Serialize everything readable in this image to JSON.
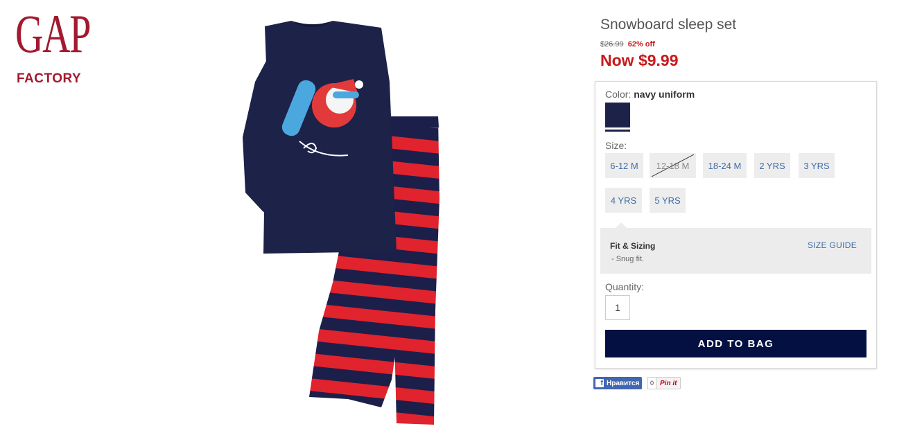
{
  "brand": {
    "name_top": "GAP",
    "name_bottom": "FACTORY",
    "color": "#a3192f"
  },
  "product": {
    "title": "Snowboard sleep set",
    "original_price": "$26.99",
    "discount": "62% off",
    "now_price": "Now $9.99",
    "image_icon": "pajama-set-image"
  },
  "options": {
    "color_label": "Color:",
    "color_value": "navy uniform",
    "swatch_color": "#1d2249",
    "size_label": "Size:",
    "sizes": [
      {
        "label": "6-12 M",
        "available": true
      },
      {
        "label": "12-18 M",
        "available": false
      },
      {
        "label": "18-24 M",
        "available": true
      },
      {
        "label": "2 YRS",
        "available": true
      },
      {
        "label": "3 YRS",
        "available": true
      },
      {
        "label": "4 YRS",
        "available": true
      },
      {
        "label": "5 YRS",
        "available": true
      }
    ]
  },
  "fit": {
    "title": "Fit & Sizing",
    "note": "- Snug fit.",
    "guide_link": "SIZE GUIDE"
  },
  "quantity": {
    "label": "Quantity:",
    "value": "1"
  },
  "cta": {
    "add_to_bag": "ADD TO BAG",
    "color": "#031041"
  },
  "social": {
    "fb_like": "Нравится",
    "fb_count": "0",
    "pinterest": "Pin it"
  },
  "colors": {
    "sale_red": "#c81a1a",
    "link_blue": "#3f6da7"
  }
}
